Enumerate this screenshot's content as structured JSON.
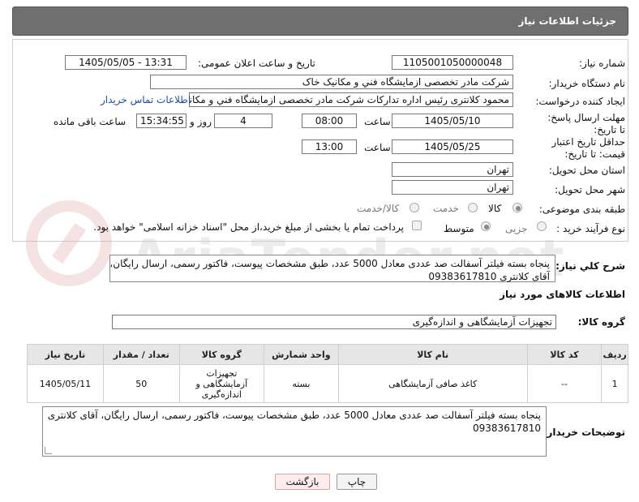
{
  "header": {
    "title": "جزئیات اطلاعات نیاز"
  },
  "watermark": "AriaTender.net",
  "form": {
    "need_number_label": "شماره نیاز:",
    "need_number": "1105001050000048",
    "announce_label": "تاریخ و ساعت اعلان عمومی:",
    "announce_value": "1405/05/05 - 13:31",
    "buyer_org_label": "نام دستگاه خریدار:",
    "buyer_org": "شرکت مادر تخصصی ازمايشگاه فني و مکانيک خاک",
    "creator_label": "ایجاد کننده درخواست:",
    "creator": "محمود کلانتری رئیس اداره تدارکات شرکت مادر تخصصی ازمايشگاه فني و مکانيک",
    "contact_link": "اطلاعات تماس خریدار",
    "reply_deadline_label": "مهلت ارسال پاسخ: تا تاریخ:",
    "reply_date": "1405/05/10",
    "time_label": "ساعت",
    "reply_time": "08:00",
    "days_value": "4",
    "days_label": "روز و",
    "remaining_time": "15:34:55",
    "remaining_label": "ساعت باقی مانده",
    "price_deadline_label": "حداقل تاریخ اعتبار قیمت: تا تاریخ:",
    "price_date": "1405/05/25",
    "price_time": "13:00",
    "province_label": "استان محل تحویل:",
    "province": "تهران",
    "city_label": "شهر محل تحویل:",
    "city": "تهران",
    "category_label": "طبقه بندی موضوعی:",
    "category_goods": "کالا",
    "category_service": "خدمت",
    "category_both": "کالا/خدمت",
    "purchase_type_label": "نوع فرآیند خرید :",
    "purchase_minor": "جزیی",
    "purchase_medium": "متوسط",
    "payment_note": "پرداخت تمام یا بخشی از مبلغ خرید،از محل \"اسناد خزانه اسلامی\" خواهد بود."
  },
  "summary": {
    "label": "شرح کلي نیاز:",
    "text_line1": "پنجاه بسته فیلتر آسفالت صد عددی معادل  5000 عدد، طبق مشخصات پیوست، فاکتور رسمی، ارسال رایگان،",
    "text_line2": "آقای کلانتری 09383617810"
  },
  "goods": {
    "section_title": "اطلاعات کالاهای مورد نیاز",
    "group_label": "گروه کالا:",
    "group_value": "تجهیزات آزمایشگاهی و اندازه‌گیری",
    "columns": [
      "ردیف",
      "کد کالا",
      "نام کالا",
      "واحد شمارش",
      "گروه کالا",
      "تعداد / مقدار",
      "تاریخ نیاز"
    ],
    "rows": [
      {
        "row": "1",
        "code": "--",
        "name": "کاغذ صافی آزمایشگاهی",
        "unit": "بسته",
        "group_l1": "تجهیزات",
        "group_l2": "آزمایشگاهی و",
        "group_l3": "اندازه‌گیری",
        "qty": "50",
        "date": "1405/05/11"
      }
    ]
  },
  "buyer_notes": {
    "label": "توضیحات خریدار:",
    "text_line1": "پنجاه بسته فیلتر آسفالت صد عددی معادل  5000 عدد، طبق مشخصات پیوست، فاکتور رسمی، ارسال رایگان، آقای کلانتری",
    "text_line2": "09383617810"
  },
  "buttons": {
    "print": "چاپ",
    "back": "بازگشت"
  }
}
